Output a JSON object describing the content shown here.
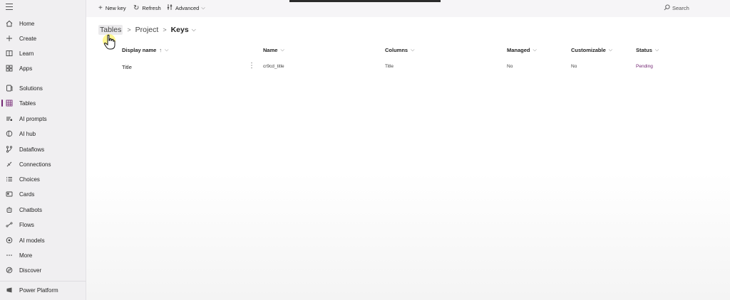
{
  "sidebar": {
    "items": [
      {
        "label": "Home",
        "icon": "home-icon"
      },
      {
        "label": "Create",
        "icon": "plus-icon"
      },
      {
        "label": "Learn",
        "icon": "book-icon"
      },
      {
        "label": "Apps",
        "icon": "apps-icon"
      },
      {
        "label": "Solutions",
        "icon": "solutions-icon"
      },
      {
        "label": "Tables",
        "icon": "table-icon",
        "active": true
      },
      {
        "label": "AI prompts",
        "icon": "ai-prompts-icon"
      },
      {
        "label": "AI hub",
        "icon": "ai-hub-icon"
      },
      {
        "label": "Dataflows",
        "icon": "dataflow-icon"
      },
      {
        "label": "Connections",
        "icon": "connection-icon"
      },
      {
        "label": "Choices",
        "icon": "list-icon"
      },
      {
        "label": "Cards",
        "icon": "card-icon"
      },
      {
        "label": "Chatbots",
        "icon": "bot-icon"
      },
      {
        "label": "Flows",
        "icon": "flow-icon"
      },
      {
        "label": "AI models",
        "icon": "ai-models-icon"
      },
      {
        "label": "More",
        "icon": "more-icon"
      },
      {
        "label": "Discover",
        "icon": "discover-icon"
      }
    ],
    "footer": {
      "label": "Power Platform",
      "icon": "power-platform-icon"
    }
  },
  "toolbar": {
    "new_key": "New key",
    "refresh": "Refresh",
    "advanced": "Advanced",
    "search": "Search"
  },
  "breadcrumb": {
    "items": [
      "Tables",
      "Project",
      "Keys"
    ]
  },
  "table": {
    "columns": [
      "Display name",
      "Name",
      "Columns",
      "Managed",
      "Customizable",
      "Status"
    ],
    "sort_indicator": "↑",
    "rows": [
      {
        "display_name": "Title",
        "name": "cr9cd_title",
        "columns": "Title",
        "managed": "No",
        "customizable": "No",
        "status": "Pending"
      }
    ]
  },
  "colors": {
    "accent": "#742774"
  }
}
